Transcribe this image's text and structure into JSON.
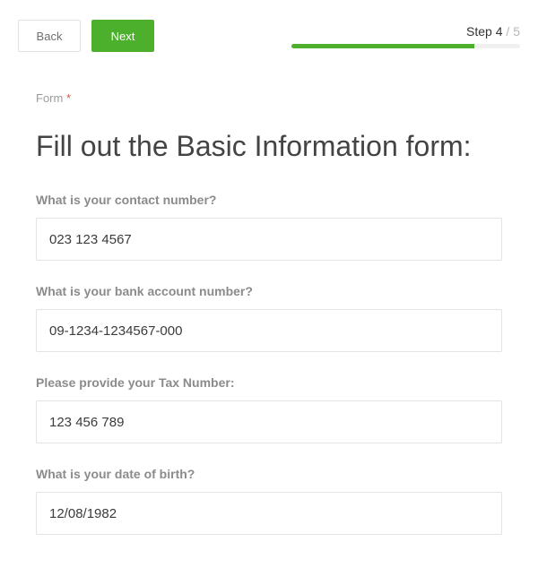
{
  "toolbar": {
    "back_label": "Back",
    "next_label": "Next"
  },
  "progress": {
    "prefix": "Step ",
    "current": "4",
    "separator": " / ",
    "total": "5",
    "percent": 80
  },
  "form": {
    "hint": "Form",
    "required_mark": "*",
    "title": "Fill out the Basic Information form:"
  },
  "fields": {
    "contact": {
      "label": "What is your contact number?",
      "value": "023 123 4567"
    },
    "bank": {
      "label": "What is your bank account number?",
      "value": "09-1234-1234567-000"
    },
    "tax": {
      "label": "Please provide your Tax Number:",
      "value": "123 456 789"
    },
    "dob": {
      "label": "What is your date of birth?",
      "value": "12/08/1982"
    }
  },
  "colors": {
    "accent": "#4db02c",
    "text_muted": "#8b8b8b",
    "border": "#e4e4e4"
  }
}
